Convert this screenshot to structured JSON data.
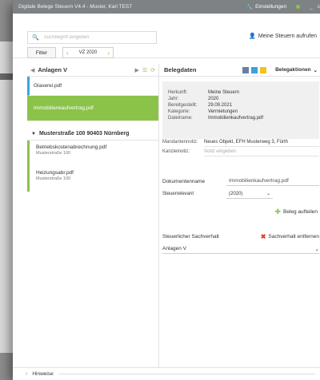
{
  "window": {
    "title": "Digitale Belege Steuern V4.4 - Muster, Karl TEST",
    "settings_label": "Einstellungen",
    "minimize": "_",
    "close_partial": "c"
  },
  "toolbar": {
    "search_placeholder": "Suchbegriff eingeben",
    "filter_label": "Filter",
    "vz_label": "VZ 2020",
    "meine_steuern": "Meine Steuern aufrufen"
  },
  "left_panel": {
    "title": "Anlagen V",
    "docs_top": [
      {
        "name": "Glaserei.pdf"
      },
      {
        "name": "Immobilienkaufvertrag.pdf"
      }
    ],
    "group": "Musterstraße 100 90403 Nürnberg",
    "docs_group": [
      {
        "name": "Betriebskostenabrechnung.pdf",
        "sub": "Musterstraße 100"
      },
      {
        "name": "Heizungsabr.pdf",
        "sub": "Musterstraße 100"
      }
    ]
  },
  "belegdaten": {
    "title": "Belegdaten",
    "aktionen": "Belegaktionen",
    "info": [
      {
        "k": "Herkunft:",
        "v": "Meine Steuern"
      },
      {
        "k": "Jahr:",
        "v": "2020"
      },
      {
        "k": "Bereitgestellt:",
        "v": "29.09.2021"
      },
      {
        "k": "Kategorie:",
        "v": "Vermietungen"
      },
      {
        "k": "Dateiname:",
        "v": "Immobilienkaufvertrag.pdf"
      }
    ],
    "mandantennotiz_label": "Mandantennotiz:",
    "mandantennotiz_value": "Neues Objekt, EFH Musterweg 3, Fürth",
    "kanzleinotiz_label": "Kanzleinotiz:",
    "kanzleinotiz_placeholder": "Notiz eingeben",
    "dokumentenname_label": "Dokumentenname",
    "dokumentenname_value": "Immobilienkaufvertrag.pdf",
    "steuerrelevant_label": "Steuerrelevant",
    "steuerrelevant_value": "(2020)",
    "aufteilen_label": "Beleg aufteilen",
    "sachverhalt_label": "Steuerlicher Sachverhalt",
    "entfernen_label": "Sachverhalt entfernen",
    "sachverhalt_value": "Anlagen V"
  },
  "footer": {
    "hinweise": "Hinweise"
  },
  "colors": {
    "accent_green": "#8bc34a",
    "accent_blue": "#3aa3dd",
    "danger": "#e53935"
  }
}
